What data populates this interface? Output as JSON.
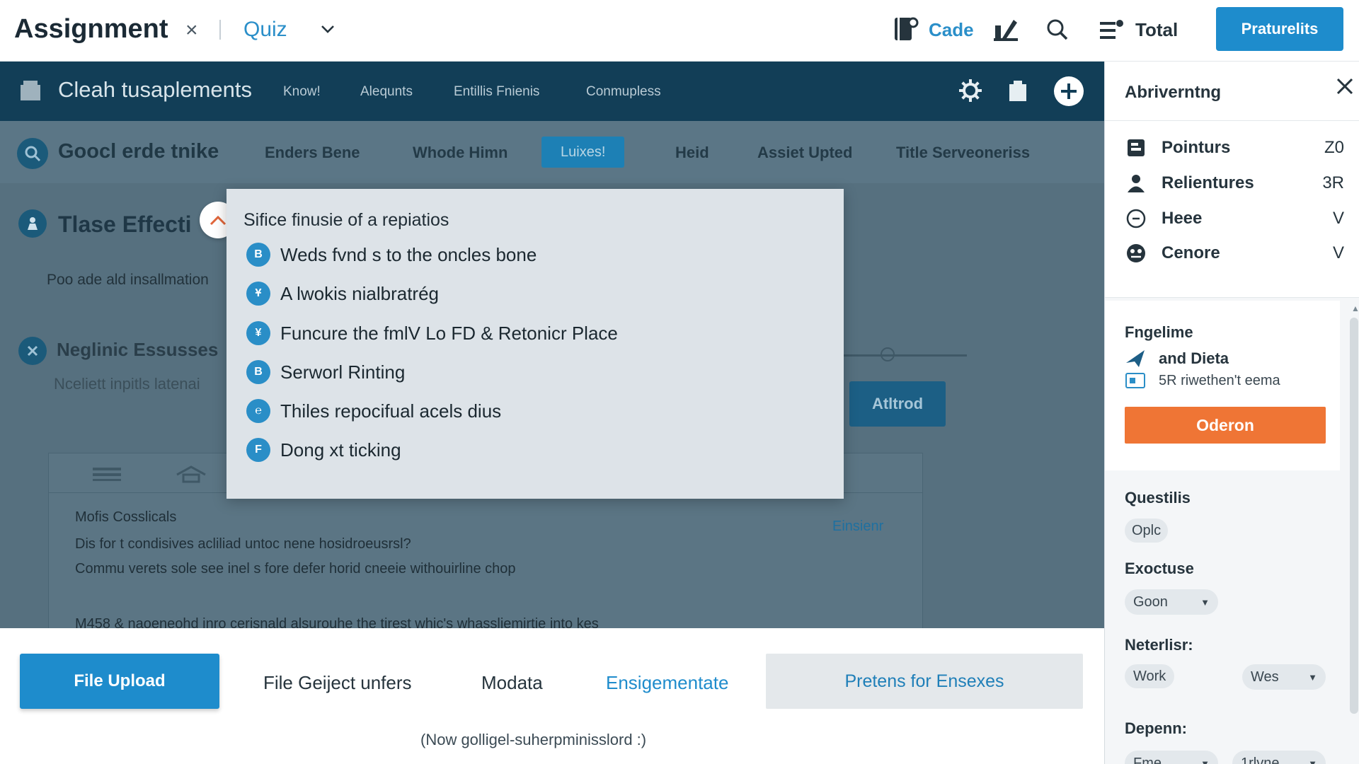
{
  "topbar": {
    "title": "Assignment",
    "close_glyph": "×",
    "quiz_tab": "Quiz",
    "cade_label": "Cade",
    "total_label": "Total",
    "primary_button": "Praturelits"
  },
  "navbar": {
    "title": "Cleah tusaplements",
    "links": [
      "Know!",
      "Alequnts",
      "Entillis Fnienis",
      "Conmupless"
    ]
  },
  "tabsbar": {
    "heading": "Goocl erde tnike",
    "tabs": [
      "Enders Bene",
      "Whode Himn",
      "Luixes!",
      "Heid",
      "Assiet Upted",
      "Title Serveoneriss"
    ],
    "active_index": 2
  },
  "content": {
    "section1_title": "Tlase Effecti",
    "section1_sub": "Poo ade ald insallmation",
    "section2_title": "Neglinic Essusses",
    "section2_sub": "Nceliett inpitls latenai",
    "attrod_button": "Atltrod",
    "row1_title": "Mofis Cosslicals",
    "row1_line1": "Dis for t condisives acliliad untoc nene hosidroeusrsl?",
    "row1_line2": "Commu verets sole see inel s fore defer horid cneeie withouirline chop",
    "row1_action": "Einsienr",
    "row2_partial": "M458 & naoeneohd inro cerisnald alsurouhe the tirest whic's whassliemirtie into kes"
  },
  "popup": {
    "title": "Sifice finusie of a repiatios",
    "items": [
      {
        "bullet": "B",
        "label": "Weds fvnd s to the oncles bone"
      },
      {
        "bullet": "Ұ",
        "label": "A lwokis nialbratrég"
      },
      {
        "bullet": "¥",
        "label": "Funcure the fmlV Lo FD & Retonicr Place"
      },
      {
        "bullet": "B",
        "label": "Serworl Rinting"
      },
      {
        "bullet": "℮",
        "label": "Thiles repocifual acels dius"
      },
      {
        "bullet": "F",
        "label": "Dong xt ticking"
      }
    ]
  },
  "bottombar": {
    "file_upload": "File Upload",
    "links": [
      "File Geiject unfers",
      "Modata",
      "Ensigementate"
    ],
    "gray_button": "Pretens for Ensexes",
    "footnote": "(Now golligel-suherpminisslord :)"
  },
  "rpanel": {
    "title": "Abriverntng",
    "items": [
      {
        "label": "Pointurs",
        "value": "Z0",
        "icon": "bookmark-icon"
      },
      {
        "label": "Relientures",
        "value": "3R",
        "icon": "person-icon"
      },
      {
        "label": "Heee",
        "value": "V",
        "icon": "clock-icon"
      },
      {
        "label": "Cenore",
        "value": "V",
        "icon": "globe-icon"
      }
    ],
    "card_title": "Fngelime",
    "card_line1": "and Dieta",
    "card_line2": "5R riwethen't eema",
    "orange_button": "Oderon",
    "questions_label": "Questilis",
    "questions_chip": "Oplc",
    "exoctuse_label": "Exoctuse",
    "exoctuse_value": "Goon",
    "neterlisr_label": "Neterlisr:",
    "neterlisr_left": "Work",
    "neterlisr_right": "Wes",
    "depenn_label": "Depenn:",
    "depenn_left": "Fme",
    "depenn_right": "1rlvne"
  },
  "colors": {
    "accent": "#1e8ccc",
    "navbar": "#123e57",
    "overlay": "#56707f",
    "orange": "#ef7535"
  }
}
